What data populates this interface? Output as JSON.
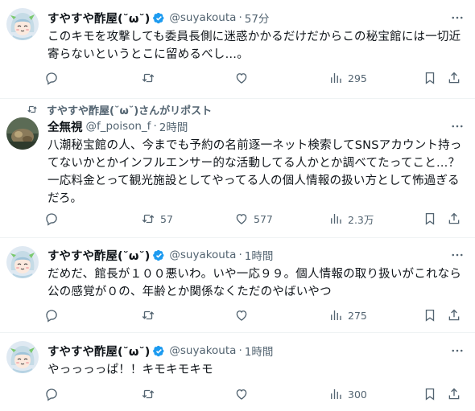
{
  "colors": {
    "verified": "#1d9bf0",
    "text": "#0f1419",
    "muted": "#536471",
    "divider": "#eff3f4"
  },
  "tweets": [
    {
      "name": "すやすや酢屋(˘ω˘)",
      "handle": "@suyakouta",
      "time": "57分",
      "verified": true,
      "text": "このキモを攻撃しても委員長側に迷惑かかるだけだからこの秘宝館には一切近寄らないというとこに留めるべし…。",
      "replies": "",
      "retweets": "",
      "likes": "",
      "views": "295"
    },
    {
      "repost_label": "すやすや酢屋(˘ω˘)さんがリポスト",
      "name": "全無視",
      "handle": "@f_poison_f",
      "time": "2時間",
      "verified": false,
      "text": "八潮秘宝館の人、今までも予約の名前逐一ネット検索してSNSアカウント持ってないかとかインフルエンサー的な活動してる人かとか調べてたってこと…？一応料金とって観光施設としてやってる人の個人情報の扱い方として怖過ぎるだろ。",
      "replies": "",
      "retweets": "57",
      "likes": "577",
      "views": "2.3万"
    },
    {
      "name": "すやすや酢屋(˘ω˘)",
      "handle": "@suyakouta",
      "time": "1時間",
      "verified": true,
      "text": "だめだ、館長が１００悪いわ。いや一応９９。個人情報の取り扱いがこれなら公の感覚が０の、年齢とか関係なくただのやばいやつ",
      "replies": "",
      "retweets": "",
      "likes": "",
      "views": "275"
    },
    {
      "name": "すやすや酢屋(˘ω˘)",
      "handle": "@suyakouta",
      "time": "1時間",
      "verified": true,
      "text": "やっっっっぱ！！キモキモキモ",
      "replies": "",
      "retweets": "",
      "likes": "",
      "views": "300"
    }
  ],
  "icons": {
    "reply": "reply-icon",
    "retweet": "retweet-icon",
    "like": "heart-icon",
    "views": "views-chart-icon",
    "bookmark": "bookmark-icon",
    "share": "share-icon",
    "more": "more-options-icon",
    "verified": "verified-badge-icon"
  }
}
